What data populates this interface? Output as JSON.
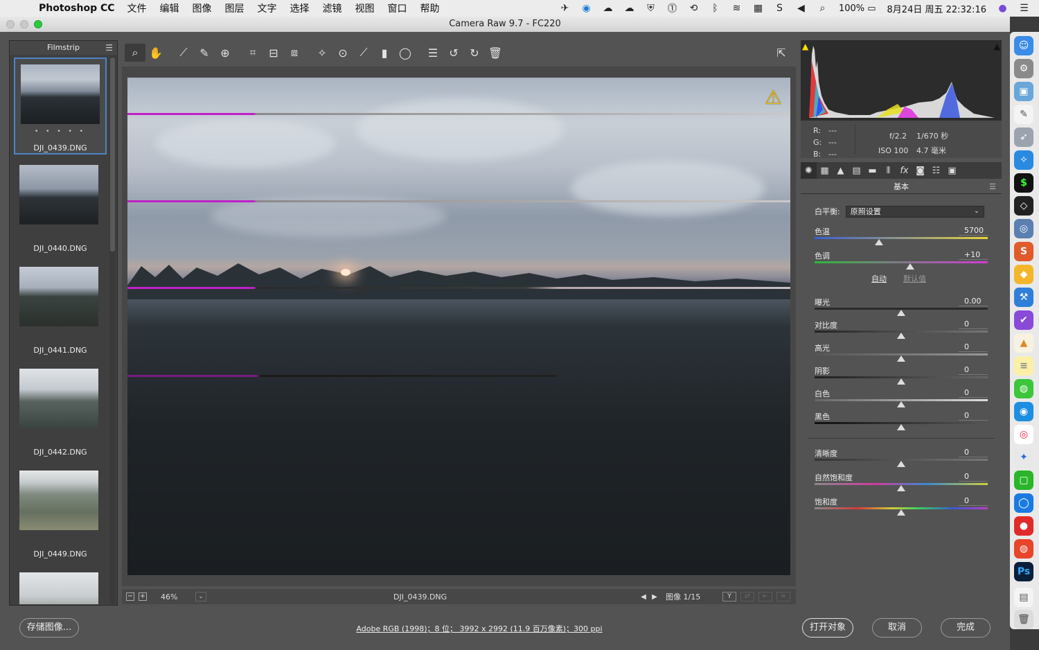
{
  "menubar": {
    "apple_icon": "apple-logo-icon",
    "app_name": "Photoshop CC",
    "menus": [
      "文件",
      "编辑",
      "图像",
      "图层",
      "文字",
      "选择",
      "滤镜",
      "视图",
      "窗口",
      "帮助"
    ],
    "status_icons": [
      "bird-icon",
      "weibo-icon",
      "wechat-icon",
      "cloud-icon",
      "shield-icon",
      "1password-icon",
      "time-machine-icon",
      "bluetooth-icon",
      "wifi-icon",
      "battery-meter-icon",
      "scribble-icon",
      "volume-icon",
      "search-icon"
    ],
    "battery": "100%",
    "datetime": "8月24日 周五 22:32:16"
  },
  "window": {
    "title": "Camera Raw 9.7 -  FC220"
  },
  "filmstrip": {
    "title": "Filmstrip",
    "rating_dots": "• • • • •",
    "items": [
      {
        "name": "DJI_0439.DNG",
        "selected": true
      },
      {
        "name": "DJI_0440.DNG",
        "selected": false
      },
      {
        "name": "DJI_0441.DNG",
        "selected": false
      },
      {
        "name": "DJI_0442.DNG",
        "selected": false
      },
      {
        "name": "DJI_0449.DNG",
        "selected": false
      },
      {
        "name": "",
        "selected": false
      }
    ]
  },
  "toolbar": {
    "tools": [
      "zoom-tool-icon",
      "hand-tool-icon",
      "white-balance-tool-icon",
      "color-sampler-icon",
      "targeted-adjustment-icon",
      "crop-tool-icon",
      "straighten-tool-icon",
      "transform-tool-icon",
      "spot-removal-icon",
      "red-eye-icon",
      "adjustment-brush-icon",
      "graduated-filter-icon",
      "radial-filter-icon",
      "preferences-icon",
      "rotate-left-icon",
      "rotate-right-icon",
      "delete-icon",
      "full-screen-icon"
    ]
  },
  "preview": {
    "warning_icon": "warning-triangle-icon",
    "warning_symbol": "⚠"
  },
  "status": {
    "zoom_out": "−",
    "zoom_in": "+",
    "zoom": "46%",
    "zoom_dropdown": "⌄",
    "filename": "DJI_0439.DNG",
    "prev": "◀",
    "next": "▶",
    "position": "图像 1/15",
    "view_toggle": "Y"
  },
  "histogram": {
    "r_label": "R:",
    "r_value": "---",
    "g_label": "G:",
    "g_value": "---",
    "b_label": "B:",
    "b_value": "---",
    "aperture": "f/2.2",
    "shutter": "1/670 秒",
    "iso": "ISO 100",
    "focal": "4.7 毫米"
  },
  "panel": {
    "title": "基本",
    "tabs": [
      "basic-icon",
      "tone-curve-icon",
      "detail-icon",
      "hsl-icon",
      "split-toning-icon",
      "lens-icon",
      "fx-icon",
      "camera-calibration-icon",
      "presets-icon",
      "snapshots-icon"
    ],
    "wb_label": "白平衡:",
    "wb_value": "原照设置",
    "temp_label": "色温",
    "temp_value": "5700",
    "tint_label": "色调",
    "tint_value": "+10",
    "auto": "自动",
    "default": "默认值",
    "exposure_label": "曝光",
    "exposure_value": "0.00",
    "contrast_label": "对比度",
    "contrast_value": "0",
    "highlights_label": "高光",
    "highlights_value": "0",
    "shadows_label": "阴影",
    "shadows_value": "0",
    "whites_label": "白色",
    "whites_value": "0",
    "blacks_label": "黑色",
    "blacks_value": "0",
    "clarity_label": "清晰度",
    "clarity_value": "0",
    "vibrance_label": "自然饱和度",
    "vibrance_value": "0",
    "saturation_label": "饱和度",
    "saturation_value": "0"
  },
  "bottom": {
    "save_label": "存储图像...",
    "workflow": "Adobe RGB (1998)；8 位；  3992 x 2992 (11.9 百万像素)；300 ppi",
    "open_label": "打开对象",
    "cancel_label": "取消",
    "done_label": "完成"
  },
  "dock": {
    "items": [
      "finder-icon",
      "system-preferences-icon",
      "preview-icon",
      "textedit-icon",
      "launchpad-icon",
      "safari-icon",
      "terminal-icon",
      "unity-icon",
      "remote-desktop-icon",
      "sublime-icon",
      "sketch-icon",
      "xcode-icon",
      "omnifocus-icon",
      "grapher-icon",
      "notes-icon",
      "wechat-icon",
      "qq-icon",
      "chrome-icon",
      "tencent-icon",
      "iqiyi-icon",
      "quicktime-icon",
      "netease-music-icon",
      "weibo-icon",
      "photoshop-icon",
      "documents-icon",
      "trash-icon"
    ]
  }
}
